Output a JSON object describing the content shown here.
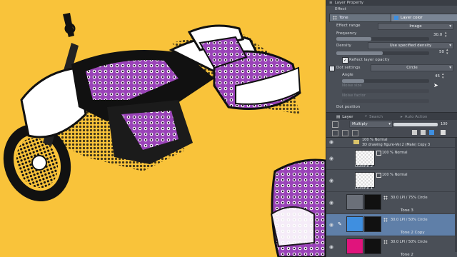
{
  "layer_property": {
    "title": "Layer Property",
    "section_effect": "Effect",
    "tone_button": "Tone",
    "layer_color_button": "Layer color",
    "effect_range_label": "Effect range",
    "effect_range_value": "Image",
    "frequency_label": "Frequency",
    "frequency_value": "30.0",
    "density_label": "Density",
    "density_value": "Use specified density",
    "density_number": "50",
    "reflect_opacity_label": "Reflect layer opacity",
    "dot_settings_label": "Dot settings",
    "dot_settings_value": "Circle",
    "angle_label": "Angle",
    "angle_value": "45",
    "noise_size_label": "Noise size",
    "noise_factor_label": "Noise factor",
    "dot_position_label": "Dot position"
  },
  "layer_panel": {
    "tab_layer": "Layer",
    "tab_search": "Search",
    "tab_auto_action": "Auto Action",
    "blend_mode": "Multiply",
    "opacity_value": "100",
    "layers": [
      {
        "name": "100 % Normal",
        "sub": "3D drawing figure-Ver.2 (Male) Copy 3",
        "type": "folder"
      },
      {
        "name": "100 % Normal",
        "sub": "Outline 2",
        "type": "raster"
      },
      {
        "name": "100 % Normal",
        "sub": "Outline 1",
        "type": "raster"
      },
      {
        "name": "30.0 LPI / 75% Circle",
        "sub": "Tone 3",
        "type": "tone"
      },
      {
        "name": "30.0 LPI / 50% Circle",
        "sub": "Tone 2 Copy",
        "type": "tone-selected"
      },
      {
        "name": "30.0 LPI / 50% Circle",
        "sub": "Tone 2",
        "type": "tone-pink"
      }
    ]
  },
  "colors": {
    "canvas_bg": "#f9c33a",
    "panel_bg": "#4a4f57",
    "selected_layer": "#5f7fa8",
    "layer_color_blue": "#3f8fe0",
    "tone_pink": "#e0147c",
    "purple_tone": "#8f3fb0"
  }
}
